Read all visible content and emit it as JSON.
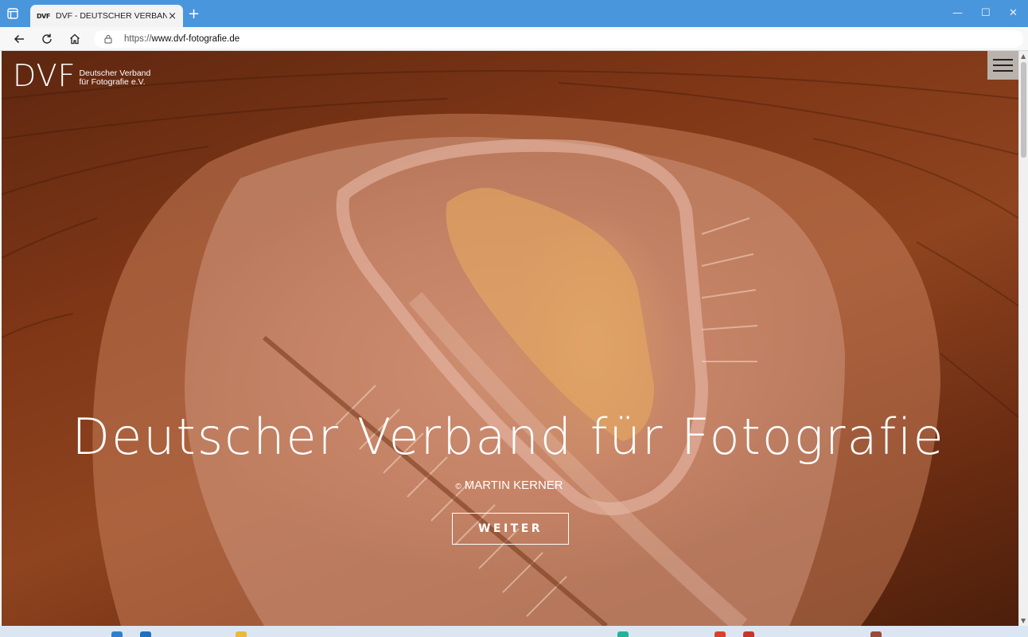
{
  "browser": {
    "tab": {
      "favicon_text": "DVF",
      "title": "DVF - DEUTSCHER VERBAND FÜ",
      "close_glyph": "×"
    },
    "new_tab_glyph": "+",
    "window_controls": {
      "minimize": "—",
      "maximize": "☐",
      "close": "✕"
    },
    "url": {
      "scheme": "https://",
      "host": "www.dvf-fotografie.de"
    },
    "icons": [
      "tab-actions-icon",
      "back-arrow-icon",
      "reload-icon",
      "home-icon",
      "lock-icon"
    ]
  },
  "site": {
    "logo": {
      "mark": "DVF",
      "line1": "Deutscher Verband",
      "line2": "für Fotografie e.V."
    },
    "menu_icon": "hamburger-menu-icon",
    "hero": {
      "title": "Deutscher Verband für Fotografie",
      "credit_symbol": "©",
      "credit_name": "MARTIN KERNER",
      "cta_label": "WEITER"
    }
  },
  "scrollbar": {
    "up": "▲",
    "down": "▼"
  },
  "colors": {
    "titlebar": "#4a96dc",
    "hero_bg_dark": "#5e2710",
    "hero_bg_mid": "#a85b3e",
    "hero_highlight": "#e9ad61",
    "menu_button_bg": "#b9b2ad"
  }
}
